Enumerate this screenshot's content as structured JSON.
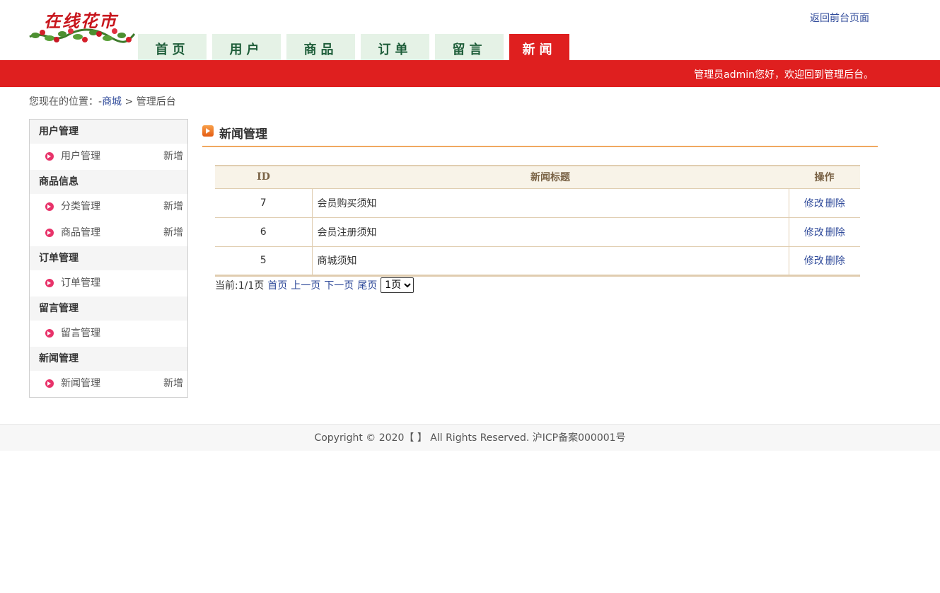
{
  "header": {
    "logo_text": "在线花市",
    "back_link": "返回前台页面",
    "nav": [
      {
        "label": "首页",
        "active": false
      },
      {
        "label": "用户",
        "active": false
      },
      {
        "label": "商品",
        "active": false
      },
      {
        "label": "订单",
        "active": false
      },
      {
        "label": "留言",
        "active": false
      },
      {
        "label": "新闻",
        "active": true
      }
    ],
    "welcome": "管理员admin您好，欢迎回到管理后台。"
  },
  "breadcrumb": {
    "prefix": "您现在的位置：-",
    "link": "商城",
    "separator": " > ",
    "current": "管理后台"
  },
  "sidebar": {
    "sections": [
      {
        "heading": "用户管理",
        "items": [
          {
            "label": "用户管理",
            "add": "新增"
          }
        ]
      },
      {
        "heading": "商品信息",
        "items": [
          {
            "label": "分类管理",
            "add": "新增"
          },
          {
            "label": "商品管理",
            "add": "新增"
          }
        ]
      },
      {
        "heading": "订单管理",
        "items": [
          {
            "label": "订单管理",
            "add": ""
          }
        ]
      },
      {
        "heading": "留言管理",
        "items": [
          {
            "label": "留言管理",
            "add": ""
          }
        ]
      },
      {
        "heading": "新闻管理",
        "items": [
          {
            "label": "新闻管理",
            "add": "新增"
          }
        ]
      }
    ]
  },
  "main": {
    "title": "新闻管理",
    "table": {
      "headers": {
        "id": "ID",
        "title": "新闻标题",
        "ops": "操作"
      },
      "rows": [
        {
          "id": "7",
          "title": "会员购买须知",
          "edit": "修改",
          "delete": "删除"
        },
        {
          "id": "6",
          "title": "会员注册须知",
          "edit": "修改",
          "delete": "删除"
        },
        {
          "id": "5",
          "title": "商城须知",
          "edit": "修改",
          "delete": "删除"
        }
      ]
    },
    "pager": {
      "current": "当前:1/1页",
      "first": "首页",
      "prev": "上一页",
      "next": "下一页",
      "last": "尾页",
      "select_value": "1页"
    }
  },
  "footer": {
    "text": "Copyright © 2020【 】 All Rights Reserved. 沪ICP备案000001号"
  },
  "colors": {
    "brand_red": "#df1f1f",
    "nav_tab_bg": "#e5f2e6",
    "nav_tab_text": "#1f5e3a",
    "link_blue": "#2f4a9a",
    "title_underline": "#f0a860",
    "table_header_bg": "#f8f3e8"
  },
  "icons": {
    "logo": "flower-vine-logo",
    "sidebar_bullet": "pink-arrow-circle-icon",
    "title": "orange-arrow-square-icon",
    "select": "chevron-down-icon"
  }
}
